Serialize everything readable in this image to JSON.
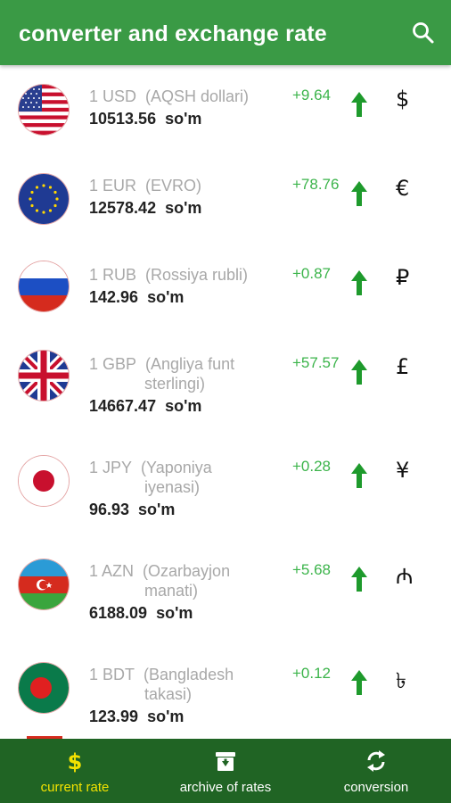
{
  "app": {
    "title": "converter and exchange rate"
  },
  "currencies": [
    {
      "code_line": "1 USD",
      "name_line1": "(AQSH dollari)",
      "name_line2": "",
      "rate": "10513.56",
      "unit": "so'm",
      "change": "+9.64",
      "symbol": "$",
      "flag": "usa-flag"
    },
    {
      "code_line": "1 EUR",
      "name_line1": "(EVRO)",
      "name_line2": "",
      "rate": "12578.42",
      "unit": "so'm",
      "change": "+78.76",
      "symbol": "€",
      "flag": "eu-flag"
    },
    {
      "code_line": "1 RUB",
      "name_line1": "(Rossiya rubli)",
      "name_line2": "",
      "rate": "142.96",
      "unit": "so'm",
      "change": "+0.87",
      "symbol": "₽",
      "flag": "russia-flag"
    },
    {
      "code_line": "1 GBP",
      "name_line1": "(Angliya funt",
      "name_line2": "sterlingi)",
      "rate": "14667.47",
      "unit": "so'm",
      "change": "+57.57",
      "symbol": "£",
      "flag": "uk-flag"
    },
    {
      "code_line": "1 JPY",
      "name_line1": "(Yaponiya",
      "name_line2": "iyenasi)",
      "rate": "96.93",
      "unit": "so'm",
      "change": "+0.28",
      "symbol": "¥",
      "flag": "japan-flag"
    },
    {
      "code_line": "1 AZN",
      "name_line1": "(Ozarbayjon",
      "name_line2": "manati)",
      "rate": "6188.09",
      "unit": "so'm",
      "change": "+5.68",
      "symbol": "₼",
      "flag": "azerbaijan-flag"
    },
    {
      "code_line": "1 BDT",
      "name_line1": "(Bangladesh",
      "name_line2": "takasi)",
      "rate": "123.99",
      "unit": "so'm",
      "change": "+0.12",
      "symbol": "৳",
      "flag": "bangladesh-flag"
    }
  ],
  "tabs": [
    {
      "label": "current rate",
      "icon": "dollar-icon",
      "active": true
    },
    {
      "label": "archive of rates",
      "icon": "archive-icon",
      "active": false
    },
    {
      "label": "conversion",
      "icon": "refresh-icon",
      "active": false
    }
  ],
  "colors": {
    "appbar": "#3a9a45",
    "bottombar": "#206424",
    "change_up": "#3cb44b",
    "active_tab": "#f2e200"
  }
}
